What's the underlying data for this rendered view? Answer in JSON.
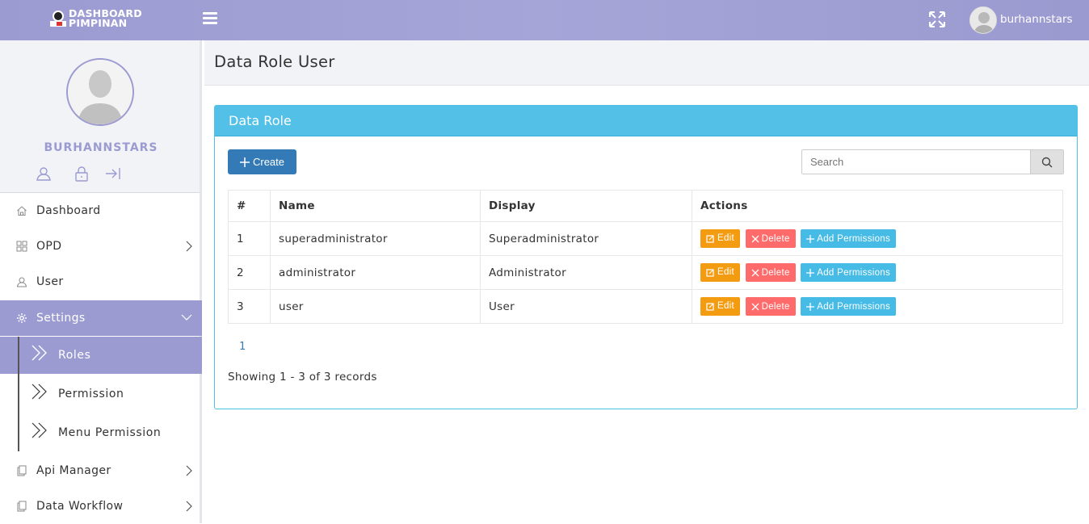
{
  "app": {
    "logo_line1": "DASHBOARD",
    "logo_line2": "PIMPINAN",
    "username": "burhannstars"
  },
  "sidebar": {
    "profile_name": "BURHANNSTARS",
    "items": [
      {
        "label": "Dashboard",
        "icon": "home-icon"
      },
      {
        "label": "OPD",
        "icon": "grid-icon"
      },
      {
        "label": "User",
        "icon": "user-icon"
      },
      {
        "label": "Settings",
        "icon": "gear-icon"
      },
      {
        "label": "Api Manager",
        "icon": "document-icon"
      },
      {
        "label": "Data Workflow",
        "icon": "document-icon"
      }
    ],
    "sub_items": [
      {
        "label": "Roles"
      },
      {
        "label": "Permission"
      },
      {
        "label": "Menu Permission"
      }
    ]
  },
  "page": {
    "title": "Data Role User",
    "panel_title": "Data Role",
    "create_label": "Create",
    "search_placeholder": "Search"
  },
  "table": {
    "headers": [
      "#",
      "Name",
      "Display",
      "Actions"
    ],
    "rows": [
      {
        "no": "1",
        "name": "superadministrator",
        "display": "Superadministrator"
      },
      {
        "no": "2",
        "name": "administrator",
        "display": "Administrator"
      },
      {
        "no": "3",
        "name": "user",
        "display": "User"
      }
    ],
    "actions": {
      "edit": "Edit",
      "delete": "Delete",
      "add": "Add Permissions"
    }
  },
  "pagination": {
    "current": "1"
  },
  "footer": {
    "showing": "Showing 1 - 3 of 3 records"
  },
  "colors": {
    "accent": "#9b9bd2",
    "panel": "#52c0e7",
    "primary": "#337ab7",
    "edit": "#f39c12",
    "delete": "#ff6b6b",
    "add": "#45bbe6"
  }
}
